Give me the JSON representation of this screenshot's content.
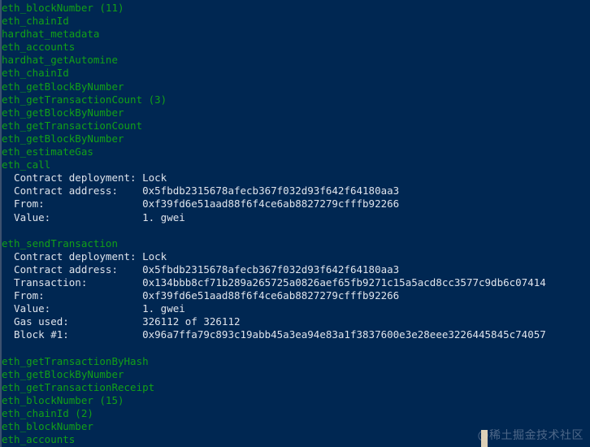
{
  "terminal": {
    "background_color": "#002752",
    "method_color": "#12a018",
    "detail_color": "#dfe4ec",
    "cursor_color": "#e8d8bc",
    "watermark": "@稀土掘金技术社区",
    "lines": [
      {
        "kind": "method",
        "text": "eth_blockNumber (11)"
      },
      {
        "kind": "method",
        "text": "eth_chainId"
      },
      {
        "kind": "method",
        "text": "hardhat_metadata"
      },
      {
        "kind": "method",
        "text": "eth_accounts"
      },
      {
        "kind": "method",
        "text": "hardhat_getAutomine"
      },
      {
        "kind": "method",
        "text": "eth_chainId"
      },
      {
        "kind": "method",
        "text": "eth_getBlockByNumber"
      },
      {
        "kind": "method",
        "text": "eth_getTransactionCount (3)"
      },
      {
        "kind": "method",
        "text": "eth_getBlockByNumber"
      },
      {
        "kind": "method",
        "text": "eth_getTransactionCount"
      },
      {
        "kind": "method",
        "text": "eth_getBlockByNumber"
      },
      {
        "kind": "method",
        "text": "eth_estimateGas"
      },
      {
        "kind": "method",
        "text": "eth_call"
      },
      {
        "kind": "detail",
        "text": "  Contract deployment: Lock"
      },
      {
        "kind": "detail",
        "text": "  Contract address:    0x5fbdb2315678afecb367f032d93f642f64180aa3"
      },
      {
        "kind": "detail",
        "text": "  From:                0xf39fd6e51aad88f6f4ce6ab8827279cfffb92266"
      },
      {
        "kind": "detail",
        "text": "  Value:               1. gwei"
      },
      {
        "kind": "blank",
        "text": " "
      },
      {
        "kind": "method",
        "text": "eth_sendTransaction"
      },
      {
        "kind": "detail",
        "text": "  Contract deployment: Lock"
      },
      {
        "kind": "detail",
        "text": "  Contract address:    0x5fbdb2315678afecb367f032d93f642f64180aa3"
      },
      {
        "kind": "detail",
        "text": "  Transaction:         0x134bbb8cf71b289a265725a0826aef65fb9271c15a5acd8cc3577c9db6c07414"
      },
      {
        "kind": "detail",
        "text": "  From:                0xf39fd6e51aad88f6f4ce6ab8827279cfffb92266"
      },
      {
        "kind": "detail",
        "text": "  Value:               1. gwei"
      },
      {
        "kind": "detail",
        "text": "  Gas used:            326112 of 326112"
      },
      {
        "kind": "detail",
        "text": "  Block #1:            0x96a7ffa79c893c19abb45a3ea94e83a1f3837600e3e28eee3226445845c74057"
      },
      {
        "kind": "blank",
        "text": " "
      },
      {
        "kind": "method",
        "text": "eth_getTransactionByHash"
      },
      {
        "kind": "method",
        "text": "eth_getBlockByNumber"
      },
      {
        "kind": "method",
        "text": "eth_getTransactionReceipt"
      },
      {
        "kind": "method",
        "text": "eth_blockNumber (15)"
      },
      {
        "kind": "method",
        "text": "eth_chainId (2)"
      },
      {
        "kind": "method",
        "text": "eth_blockNumber"
      },
      {
        "kind": "method",
        "text": "eth_accounts"
      }
    ]
  }
}
